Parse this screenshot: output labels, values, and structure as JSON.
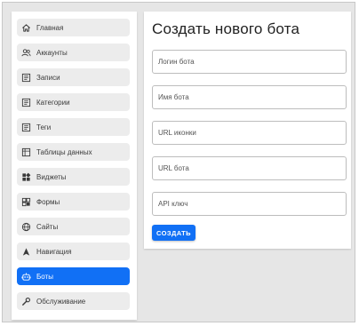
{
  "sidebar": {
    "items": [
      {
        "label": "Главная",
        "icon": "home-icon"
      },
      {
        "label": "Аккаунты",
        "icon": "users-icon"
      },
      {
        "label": "Записи",
        "icon": "posts-icon"
      },
      {
        "label": "Категории",
        "icon": "categories-icon"
      },
      {
        "label": "Теги",
        "icon": "tags-icon"
      },
      {
        "label": "Таблицы данных",
        "icon": "table-icon"
      },
      {
        "label": "Виджеты",
        "icon": "widgets-icon"
      },
      {
        "label": "Формы",
        "icon": "forms-icon"
      },
      {
        "label": "Сайты",
        "icon": "globe-icon"
      },
      {
        "label": "Навигация",
        "icon": "navigation-icon"
      },
      {
        "label": "Боты",
        "icon": "bot-icon",
        "active": true
      },
      {
        "label": "Обслуживание",
        "icon": "wrench-icon"
      }
    ]
  },
  "main": {
    "title": "Создать нового бота",
    "fields": [
      {
        "placeholder": "Логин бота",
        "value": ""
      },
      {
        "placeholder": "Имя бота",
        "value": ""
      },
      {
        "placeholder": "URL иконки",
        "value": ""
      },
      {
        "placeholder": "URL бота",
        "value": ""
      },
      {
        "placeholder": "API ключ",
        "value": ""
      }
    ],
    "submit_label": "СОЗДАТЬ"
  },
  "colors": {
    "accent": "#1170f5",
    "background": "#e6e6e6",
    "nav_item": "#ececec"
  }
}
